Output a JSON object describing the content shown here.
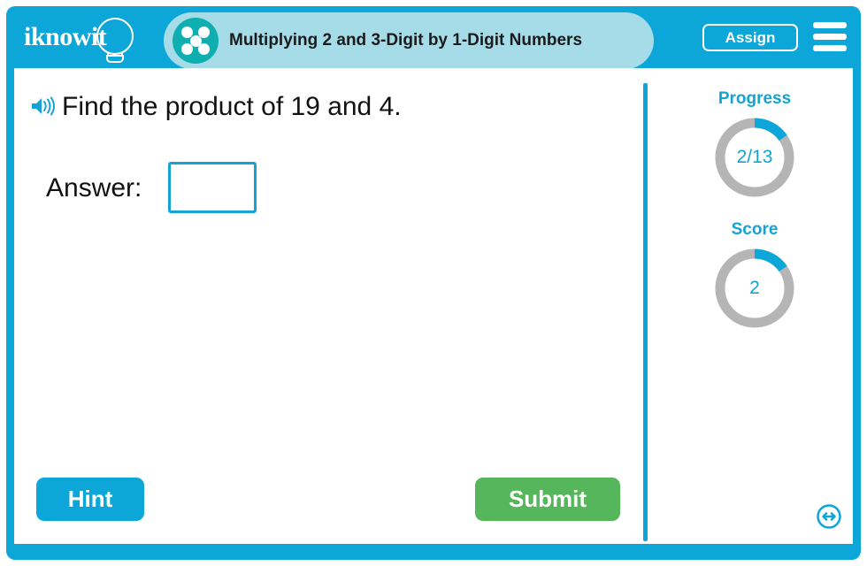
{
  "brand": {
    "logo_text": "iknowit",
    "logo_icon": "lightbulb-icon"
  },
  "header": {
    "subject_icon": "five-dots-circle-icon",
    "title": "Multiplying 2 and 3-Digit by 1-Digit Numbers",
    "assign_label": "Assign",
    "menu_icon": "hamburger-menu-icon",
    "bar_color": "#0CA6D8",
    "pill_color": "#A5DCE8",
    "icon_color": "#0FAEB0"
  },
  "question": {
    "audio_icon": "speaker-icon",
    "text": "Find the product of 19 and 4.",
    "answer_label": "Answer:",
    "answer_value": "",
    "answer_placeholder": ""
  },
  "actions": {
    "hint_label": "Hint",
    "hint_color": "#0CA6D8",
    "submit_label": "Submit",
    "submit_color": "#56B65B"
  },
  "side_panel": {
    "progress": {
      "title": "Progress",
      "value": "2/13",
      "current": 2,
      "total": 13,
      "percent": 15.4,
      "arc_color": "#0CA6D8",
      "track_color": "#B5B5B5"
    },
    "score": {
      "title": "Score",
      "value": "2",
      "current": 2,
      "total": 13,
      "percent": 15.4,
      "arc_color": "#0CA6D8",
      "track_color": "#B5B5B5"
    },
    "resize_icon": "resize-horizontal-icon"
  }
}
